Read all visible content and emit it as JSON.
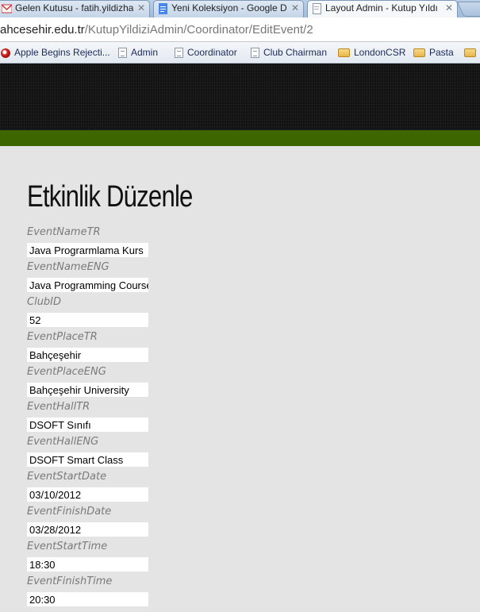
{
  "browser": {
    "tabs": [
      {
        "title": "Gelen Kutusu - fatih.yildizha",
        "icon": "gmail-icon",
        "active": false
      },
      {
        "title": "Yeni Koleksiyon - Google Do",
        "icon": "docs-icon",
        "active": false
      },
      {
        "title": "Layout Admin - Kutup Yıldı",
        "icon": "page-icon",
        "active": true
      }
    ],
    "address": {
      "host": "ahcesehir.edu.tr",
      "path": "/KutupYildiziAdmin/Coordinator/EditEvent/2"
    },
    "bookmarks": [
      {
        "label": "Apple Begins Rejecti...",
        "icon": "apple-icon"
      },
      {
        "label": "Admin",
        "icon": "page-icon"
      },
      {
        "label": "Coordinator",
        "icon": "page-icon"
      },
      {
        "label": "Club Chairman",
        "icon": "page-icon"
      },
      {
        "label": "LondonCSR",
        "icon": "folder-icon"
      },
      {
        "label": "Pasta",
        "icon": "folder-icon"
      },
      {
        "label": "",
        "icon": "folder-icon"
      }
    ]
  },
  "page": {
    "title": "Etkinlik Düzenle",
    "fields": [
      {
        "label": "EventNameTR",
        "value": "Java Prograrmlama Kurs"
      },
      {
        "label": "EventNameENG",
        "value": "Java Programming Course"
      },
      {
        "label": "ClubID",
        "value": "52"
      },
      {
        "label": "EventPlaceTR",
        "value": "Bahçeşehir"
      },
      {
        "label": "EventPlaceENG",
        "value": "Bahçeşehir University"
      },
      {
        "label": "EventHallTR",
        "value": "DSOFT Sınıfı"
      },
      {
        "label": "EventHallENG",
        "value": "DSOFT Smart Class"
      },
      {
        "label": "EventStartDate",
        "value": "03/10/2012"
      },
      {
        "label": "EventFinishDate",
        "value": "03/28/2012"
      },
      {
        "label": "EventStartTime",
        "value": "18:30"
      },
      {
        "label": "EventFinishTime",
        "value": "20:30"
      }
    ]
  },
  "colors": {
    "header_bg": "#121212",
    "green_band": "#3d6600",
    "page_bg": "#e4e4e4"
  }
}
